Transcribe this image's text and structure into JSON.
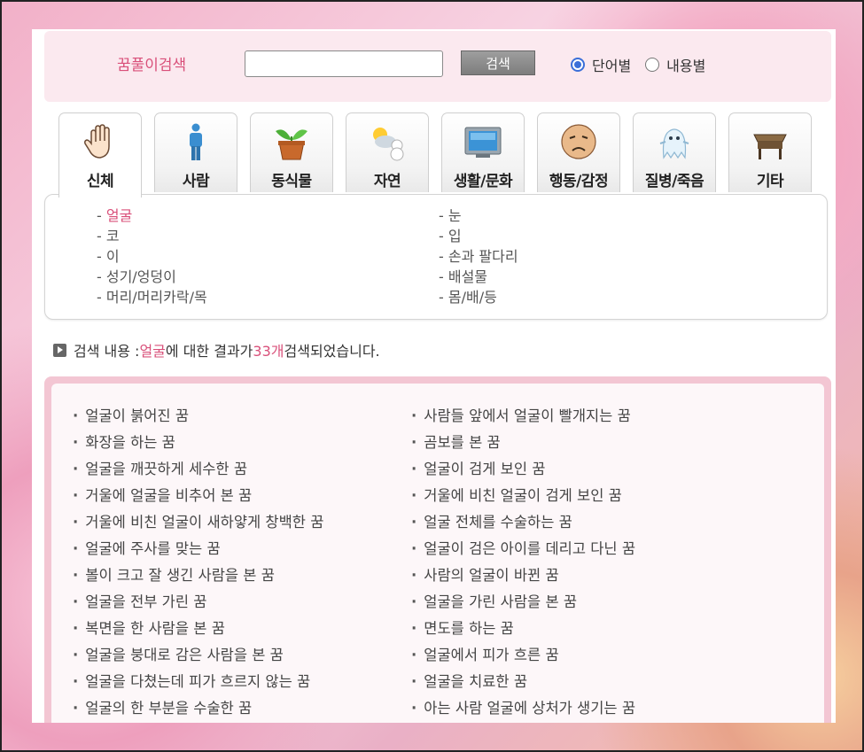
{
  "search": {
    "label": "꿈풀이검색",
    "input_value": "",
    "button_label": "검색",
    "radio_word": "단어별",
    "radio_content": "내용별",
    "selected": "단어별"
  },
  "tabs": [
    {
      "label": "신체",
      "icon": "hand-icon",
      "active": true
    },
    {
      "label": "사람",
      "icon": "person-icon"
    },
    {
      "label": "동식물",
      "icon": "plant-pot-icon"
    },
    {
      "label": "자연",
      "icon": "weather-icon"
    },
    {
      "label": "생활/문화",
      "icon": "tv-icon"
    },
    {
      "label": "행동/감정",
      "icon": "sad-face-icon"
    },
    {
      "label": "질병/죽음",
      "icon": "ghost-icon"
    },
    {
      "label": "기타",
      "icon": "table-icon"
    }
  ],
  "categories": {
    "left": [
      "얼굴",
      "코",
      "이",
      "성기/엉덩이",
      "머리/머리카락/목"
    ],
    "right": [
      "눈",
      "입",
      "손과 팔다리",
      "배설물",
      "몸/배/등"
    ],
    "selected": "얼굴"
  },
  "summary": {
    "prefix": "검색 내용 : ",
    "keyword": "얼굴",
    "middle": "에 대한 결과가 ",
    "count": "33개",
    "suffix": " 검색되었습니다."
  },
  "results": {
    "left": [
      "얼굴이 붉어진 꿈",
      "화장을 하는 꿈",
      "얼굴을 깨끗하게 세수한 꿈",
      "거울에 얼굴을 비추어 본 꿈",
      "거울에 비친 얼굴이 새하얗게 창백한 꿈",
      "얼굴에 주사를 맞는 꿈",
      "볼이 크고 잘 생긴 사람을 본 꿈",
      "얼굴을 전부 가린 꿈",
      "복면을 한 사람을 본 꿈",
      "얼굴을 붕대로 감은 사람을 본 꿈",
      "얼굴을 다쳤는데 피가 흐르지 않는 꿈",
      "얼굴의 한 부분을 수술한 꿈"
    ],
    "right": [
      "사람들 앞에서 얼굴이 빨개지는 꿈",
      "곰보를 본 꿈",
      "얼굴이 검게 보인 꿈",
      "거울에 비친 얼굴이 검게 보인 꿈",
      "얼굴 전체를 수술하는 꿈",
      "얼굴이 검은 아이를 데리고 다닌 꿈",
      "사람의 얼굴이 바뀐 꿈",
      "얼굴을 가린 사람을 본 꿈",
      "면도를 하는 꿈",
      "얼굴에서 피가 흐른 꿈",
      "얼굴을 치료한 꿈",
      "아는 사람 얼굴에 상처가 생기는 꿈"
    ]
  },
  "colors": {
    "accent": "#d9507a",
    "results_border": "#f3c6d3",
    "search_bg": "#fbe9ef"
  }
}
